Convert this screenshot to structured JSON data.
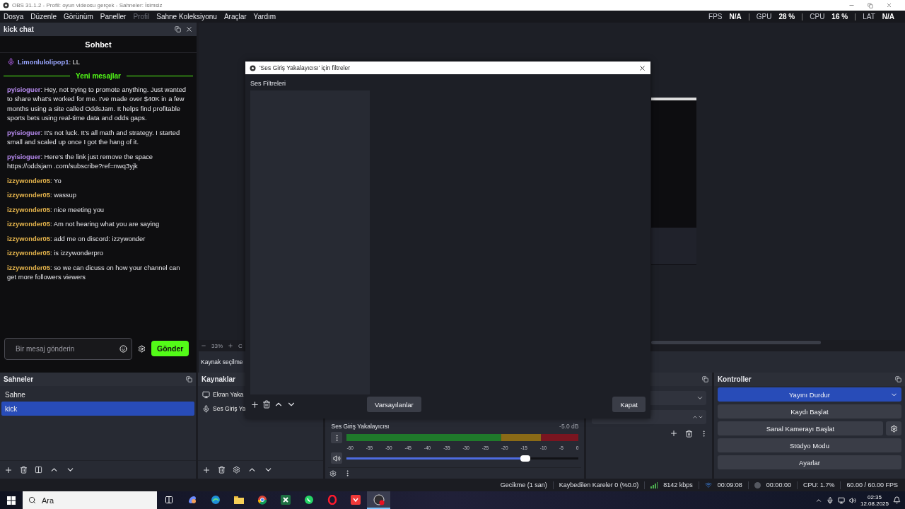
{
  "window": {
    "title": "OBS 31.1.2 - Profil: oyun videosu gerçek - Sahneler: İsimsiz"
  },
  "menu": [
    {
      "label": "Dosya",
      "disabled": false
    },
    {
      "label": "Düzenle",
      "disabled": false
    },
    {
      "label": "Görünüm",
      "disabled": false
    },
    {
      "label": "Paneller",
      "disabled": false
    },
    {
      "label": "Profil",
      "disabled": true
    },
    {
      "label": "Sahne Koleksiyonu",
      "disabled": false
    },
    {
      "label": "Araçlar",
      "disabled": false
    },
    {
      "label": "Yardım",
      "disabled": false
    }
  ],
  "stats": [
    {
      "label": "FPS",
      "value": "N/A"
    },
    {
      "label": "GPU",
      "value": "28 %"
    },
    {
      "label": "CPU",
      "value": "16 %"
    },
    {
      "label": "LAT",
      "value": "N/A"
    }
  ],
  "chat_dock": {
    "title": "kick chat",
    "header": "Sohbet",
    "pinned": {
      "user": "Limonlulolipop1",
      "color": "#9aa6ff",
      "text": ": LL"
    },
    "divider": "Yeni mesajlar",
    "messages": [
      {
        "user": "pyisioguer",
        "color": "#b98cf2",
        "text": ": Hey, not trying to promote anything. Just wanted to share what's worked for me. I've made over $40K in a few months using a site called OddsJam. It helps find profitable sports bets using real-time data and odds gaps."
      },
      {
        "user": "pyisioguer",
        "color": "#b98cf2",
        "text": ": It's not luck. It's all math and strategy. I started small and scaled up once I got the hang of it."
      },
      {
        "user": "pyisioguer",
        "color": "#b98cf2",
        "text": ": Here's the link just remove the space https://oddsjam .com/subscribe?ref=nwq3yjk"
      },
      {
        "user": "izzywonder05",
        "color": "#e6b54c",
        "text": ": Yo"
      },
      {
        "user": "izzywonder05",
        "color": "#e6b54c",
        "text": ": wassup"
      },
      {
        "user": "izzywonder05",
        "color": "#e6b54c",
        "text": ": nice meeting you"
      },
      {
        "user": "izzywonder05",
        "color": "#e6b54c",
        "text": ": Am not hearing what you are saying"
      },
      {
        "user": "izzywonder05",
        "color": "#e6b54c",
        "text": ": add me on discord: izzywonder"
      },
      {
        "user": "izzywonder05",
        "color": "#e6b54c",
        "text": ": is izzywonderpro"
      },
      {
        "user": "izzywonder05",
        "color": "#e6b54c",
        "text": ": so we can dicuss on how your channel can get more followers viewers"
      }
    ],
    "input": {
      "placeholder": "Bir mesaj gönderin"
    },
    "send": "Gönder"
  },
  "preview": {
    "zoom": "33%",
    "cut_label": "C",
    "source_status": "Kaynak seçilme"
  },
  "scenes": {
    "title": "Sahneler",
    "items": [
      {
        "label": "Sahne",
        "selected": false
      },
      {
        "label": "kick",
        "selected": true
      }
    ]
  },
  "sources": {
    "title": "Kaynaklar",
    "items": [
      {
        "label": "Ekran Yaka",
        "kind": "display"
      },
      {
        "label": "Ses Giriş Ya",
        "kind": "mic"
      }
    ]
  },
  "mixer": {
    "channels": [
      {
        "name": "Ses Giriş Yakalayıcısı",
        "reading": "-5.0 dB",
        "level": 0.77
      }
    ],
    "ticks": [
      "-60",
      "-55",
      "-50",
      "-45",
      "-40",
      "-35",
      "-30",
      "-25",
      "-20",
      "-15",
      "-10",
      "-5",
      "0"
    ]
  },
  "controls": {
    "title": "Kontroller",
    "buttons": [
      {
        "label": "Yayını Durdur",
        "kind": "stream",
        "checked": true
      },
      {
        "label": "Kaydı Başlat",
        "kind": "plain",
        "checked": false
      },
      {
        "label": "Sanal Kamerayı Başlat",
        "kind": "with_settings",
        "checked": false
      },
      {
        "label": "Stüdyo Modu",
        "kind": "plain",
        "checked": false
      },
      {
        "label": "Ayarlar",
        "kind": "plain",
        "checked": false
      }
    ]
  },
  "dialog": {
    "title": "'Ses Giriş Yakalayıcısı' için filtreler",
    "section": "Ses Filtreleri",
    "defaults_button": "Varsayılanlar",
    "close_button": "Kapat"
  },
  "status_bar": [
    {
      "kind": "text",
      "text": "Gecikme (1 san)"
    },
    {
      "kind": "text",
      "text": "Kaybedilen Kareler 0 (%0.0)"
    },
    {
      "kind": "bitrate",
      "text": "8142 kbps"
    },
    {
      "kind": "stream_time",
      "text": "00:09:08"
    },
    {
      "kind": "record_time",
      "text": "00:00:00"
    },
    {
      "kind": "text",
      "text": "CPU: 1.7%"
    },
    {
      "kind": "text",
      "text": "60.00 / 60.00 FPS"
    }
  ],
  "taskbar": {
    "search_placeholder": "Ara",
    "apps": [
      {
        "kind": "assistant",
        "active": false
      },
      {
        "kind": "browser_wave",
        "active": false
      },
      {
        "kind": "folder",
        "active": false
      },
      {
        "kind": "browser_round",
        "active": false
      },
      {
        "kind": "spreadsheet",
        "active": false
      },
      {
        "kind": "messenger",
        "active": false
      },
      {
        "kind": "browser_ring",
        "active": false
      },
      {
        "kind": "red_app",
        "active": false
      },
      {
        "kind": "recorder",
        "active": true
      }
    ],
    "time": "02:35",
    "date": "12.08.2025"
  }
}
